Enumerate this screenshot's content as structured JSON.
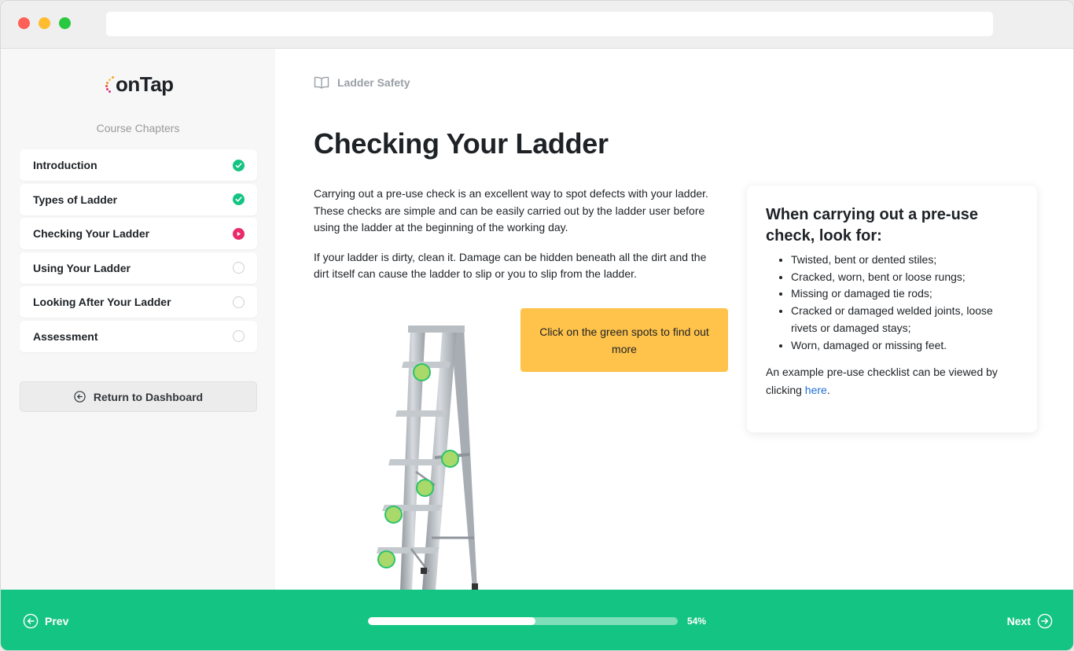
{
  "brand": {
    "name": "onTap"
  },
  "sidebar": {
    "chapters_title": "Course Chapters",
    "chapters": [
      {
        "label": "Introduction",
        "status": "complete"
      },
      {
        "label": "Types of Ladder",
        "status": "complete"
      },
      {
        "label": "Checking Your Ladder",
        "status": "current"
      },
      {
        "label": "Using Your Ladder",
        "status": "incomplete"
      },
      {
        "label": "Looking After Your Ladder",
        "status": "incomplete"
      },
      {
        "label": "Assessment",
        "status": "incomplete"
      }
    ],
    "return_label": "Return to Dashboard"
  },
  "main": {
    "breadcrumb": "Ladder Safety",
    "title": "Checking Your Ladder",
    "paragraphs": [
      "Carrying out a pre-use check is an excellent way to spot defects with your ladder. These checks are simple and can be easily carried out by the ladder user before using the ladder at the beginning of the working day.",
      "If your ladder is dirty, clean it. Damage can be hidden beneath all the dirt and the dirt itself can cause the ladder to slip or you to slip from the ladder."
    ],
    "callout": "Click on the green spots to find out more",
    "hotspot_count": 5
  },
  "card": {
    "title": "When carrying out a pre-use check, look for:",
    "items": [
      "Twisted, bent or dented stiles;",
      "Cracked, worn, bent or loose rungs;",
      "Missing or damaged tie rods;",
      "Cracked or damaged welded joints, loose rivets or damaged stays;",
      "Worn, damaged or missing feet."
    ],
    "note_prefix": "An example pre-use checklist can be viewed by clicking ",
    "note_link": "here",
    "note_suffix": "."
  },
  "footer": {
    "prev_label": "Prev",
    "next_label": "Next",
    "progress_percent": 54,
    "progress_label": "54%"
  },
  "colors": {
    "accent_green": "#14c482",
    "current_pink": "#ea2b6a",
    "callout_yellow": "#ffc24a",
    "link_blue": "#1f6fd6"
  }
}
